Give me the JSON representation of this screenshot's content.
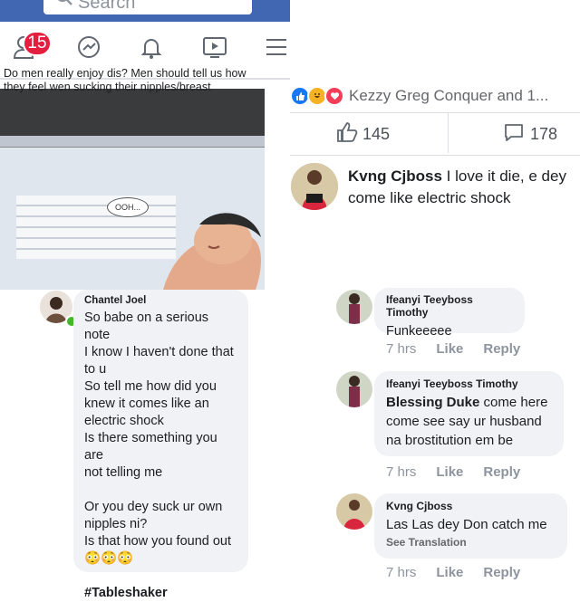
{
  "header": {
    "search_placeholder": "Search",
    "notifications_count": "15",
    "icons": [
      "friends-icon",
      "messenger-icon",
      "bell-icon",
      "watch-icon",
      "menu-icon"
    ],
    "brand_color": "#4267b2",
    "badge_color": "#e41e3f"
  },
  "meme": {
    "caption": "Do men really enjoy dis? Men should tell us how they feel wen sucking their nipples/breast",
    "bubble": "OOH..."
  },
  "post_stats": {
    "reactors": "Kezzy Greg Conquer and 1...",
    "likes": "145",
    "comments": "178"
  },
  "comments": {
    "c1": {
      "author": "Kvng Cjboss",
      "text": "I love it die,  e dey come like electric shock"
    },
    "c2": {
      "author": "Chantel Joel",
      "lines": [
        "So babe on a serious note",
        "I know I haven't done that",
        "to u",
        "So tell me how did you",
        "knew it comes like an",
        "electric shock",
        "Is there something you are",
        "not telling me",
        "",
        "Or you dey suck ur own",
        "nipples ni?",
        "Is that how you found out",
        "😳😳😳",
        "",
        "#Tableshaker"
      ]
    },
    "c3": {
      "author": "Ifeanyi Teeyboss Timothy",
      "text": "Funkeeeee",
      "time": "7 hrs",
      "like": "Like",
      "reply": "Reply"
    },
    "c4": {
      "author": "Ifeanyi Teeyboss Timothy",
      "mention": "Blessing Duke",
      "text": " come here come see say ur husband na brostitution em be",
      "time": "7 hrs",
      "like": "Like",
      "reply": "Reply"
    },
    "c5": {
      "author": "Kvng Cjboss",
      "text": "Las Las dey Don catch me",
      "translate": "See Translation",
      "time": "7 hrs",
      "like": "Like",
      "reply": "Reply"
    }
  }
}
